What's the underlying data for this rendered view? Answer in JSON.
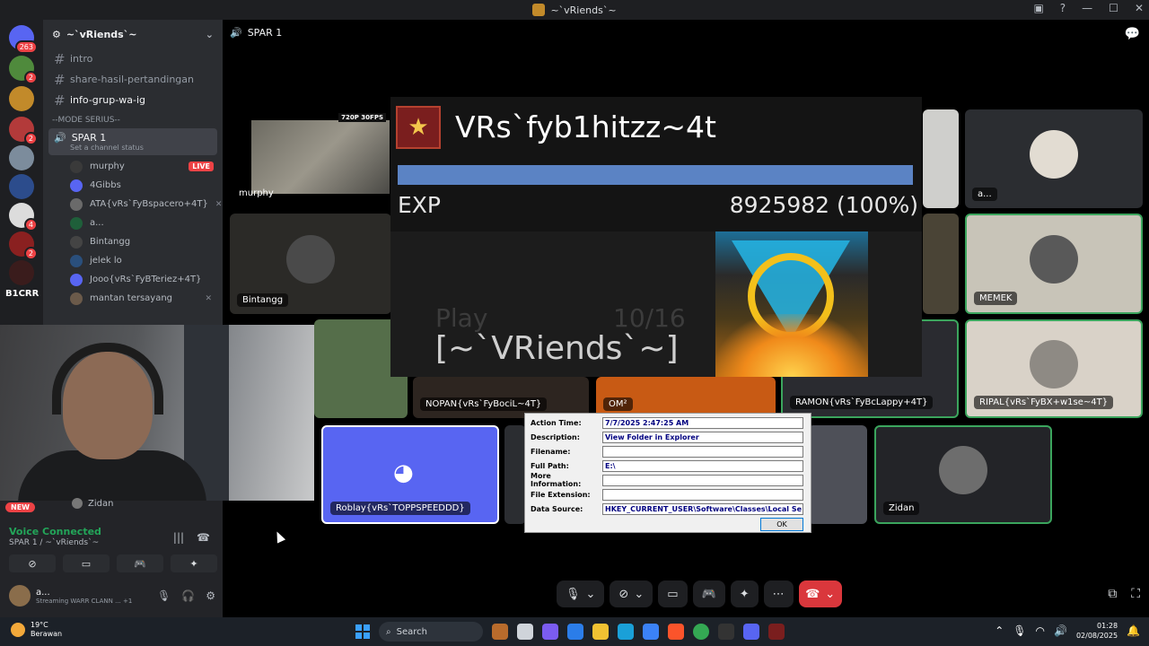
{
  "window": {
    "title": "~`vRiends`~"
  },
  "servers": {
    "home_badge": "263",
    "badge_2a": "2",
    "badge_2b": "2",
    "badge_4": "4",
    "badge_2c": "2",
    "label_text": "B1CRR"
  },
  "guild": {
    "name": "~`vRiends`~",
    "channels": [
      {
        "name": "intro"
      },
      {
        "name": "share-hasil-pertandingan"
      },
      {
        "name": "info-grup-wa-ig"
      }
    ],
    "category": "--MODE SERIUS--",
    "voice_channel": {
      "name": "SPAR 1",
      "status": "Set a channel status"
    },
    "voice_users": [
      {
        "name": "murphy",
        "badge": "LIVE"
      },
      {
        "name": "4Gibbs"
      },
      {
        "name": "ATA{vRs`FyBspacero+4T}"
      },
      {
        "name": "a..."
      },
      {
        "name": "Bintangg"
      },
      {
        "name": "jelek lo"
      },
      {
        "name": "Jooo{vRs`FyBTeriez+4T}"
      },
      {
        "name": "mantan tersayang"
      }
    ]
  },
  "panel": {
    "new_badge": "NEW",
    "zidan_label": "Zidan",
    "voice_connected": "Voice Connected",
    "voice_location": "SPAR 1 / ~`vRiends`~",
    "user_name": "a...",
    "user_status": "Streaming WARR CLANN ...",
    "user_plus": "+1"
  },
  "stage": {
    "channel": "SPAR 1",
    "stream_quality": "720P 30FPS",
    "tiles": {
      "murphy": "murphy",
      "bintangg": "Bintangg",
      "a": "a...",
      "memek": "MEMEK",
      "nopan": "NOPAN{vRs`FyBociL~4T}",
      "om": "OM²",
      "ramon": "RAMON{vRs`FyBcLappy+4T}",
      "ripal": "RIPAL{vRs`FyBX+w1se~4T}",
      "roblay": "Roblay{vRs`TOPPSPEEDDD}",
      "zidan": "Zidan"
    }
  },
  "overlay": {
    "player_name": "VRs`fyb1hitzz~4t",
    "exp_label": "EXP",
    "exp_value": "8925982 (100%)",
    "exp_progress": 1.0,
    "play_label": "Play",
    "play_count": "10/16",
    "guild_name": "[~`VRiends`~]"
  },
  "dialog": {
    "rows": [
      {
        "label": "Action Time:",
        "value": "7/7/2025 2:47:25 AM"
      },
      {
        "label": "Description:",
        "value": "View Folder in Explorer"
      },
      {
        "label": "Filename:",
        "value": ""
      },
      {
        "label": "Full Path:",
        "value": "E:\\"
      },
      {
        "label": "More Information:",
        "value": ""
      },
      {
        "label": "File Extension:",
        "value": ""
      },
      {
        "label": "Data Source:",
        "value": "HKEY_CURRENT_USER\\Software\\Classes\\Local Se"
      }
    ],
    "ok_label": "OK"
  },
  "taskbar": {
    "temp": "19°C",
    "weather_desc": "Berawan",
    "search_placeholder": "Search",
    "time": "01:28",
    "date": "02/08/2025"
  },
  "colors": {
    "blurple": "#5865f2",
    "green": "#23a559",
    "red": "#da373c",
    "exp_bar": "#5b83c4"
  }
}
